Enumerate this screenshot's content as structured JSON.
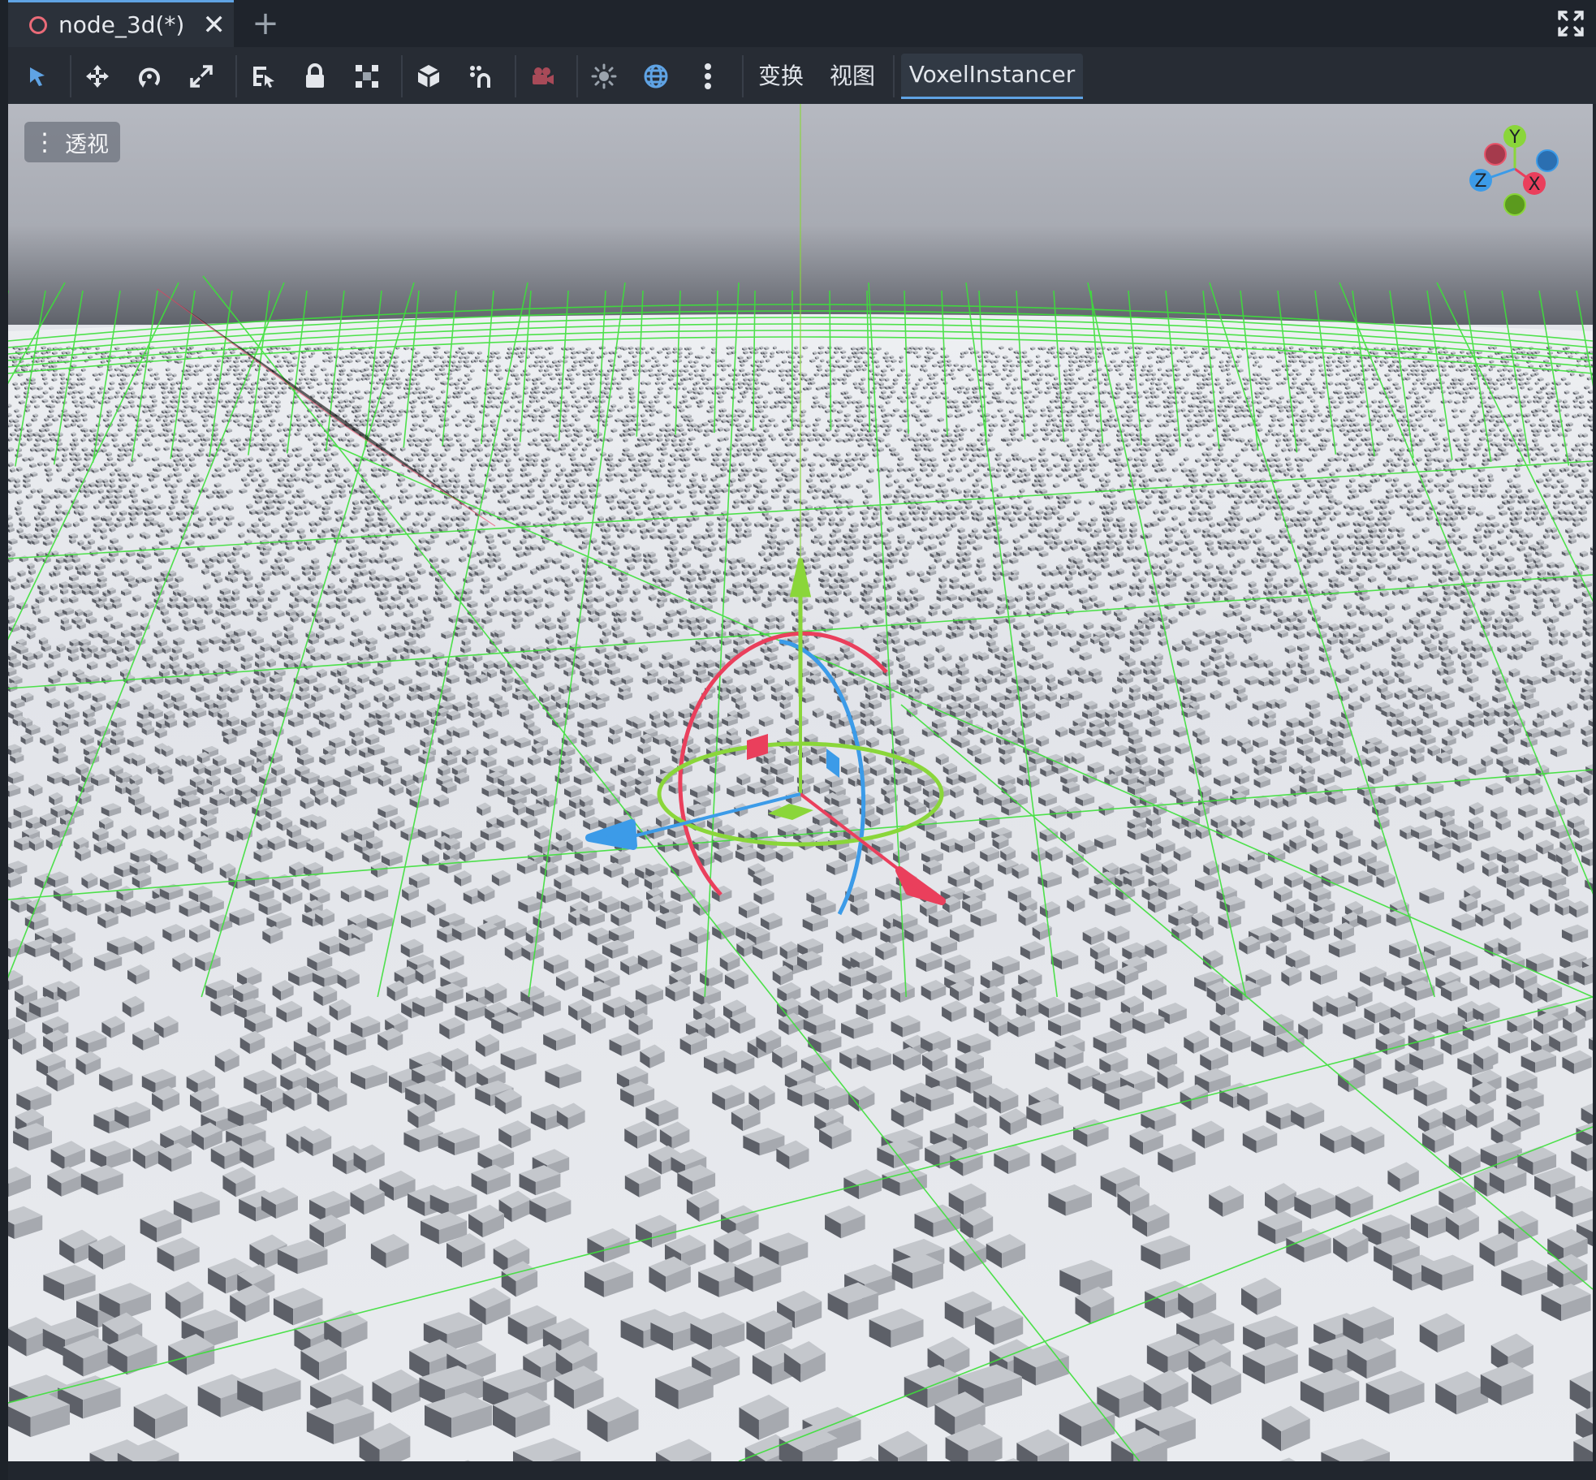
{
  "tab": {
    "title": "node_3d(*)",
    "close_glyph": "✕",
    "add_glyph": "+"
  },
  "toolbar": {
    "icons": [
      "select-icon",
      "move-icon",
      "rotate-icon",
      "scale-icon",
      "list-select-icon",
      "lock-icon",
      "group-icon",
      "cube-icon",
      "snap-icon",
      "camera-icon",
      "sun-icon",
      "globe-icon",
      "more-vertical-icon"
    ],
    "transform_label": "变换",
    "view_label": "视图",
    "plugin_label": "VoxelInstancer"
  },
  "viewport": {
    "perspective_label": "透视",
    "gizmo": {
      "y_label": "Y",
      "x_label": "X",
      "z_label": "Z"
    }
  },
  "colors": {
    "accent": "#5fa3e4",
    "x_axis": "#ea3f5c",
    "y_axis": "#8ad63a",
    "z_axis": "#3c9be8",
    "grid": "#3de03a",
    "sky": "#b7bac2",
    "ground": "#e6e8ec"
  }
}
